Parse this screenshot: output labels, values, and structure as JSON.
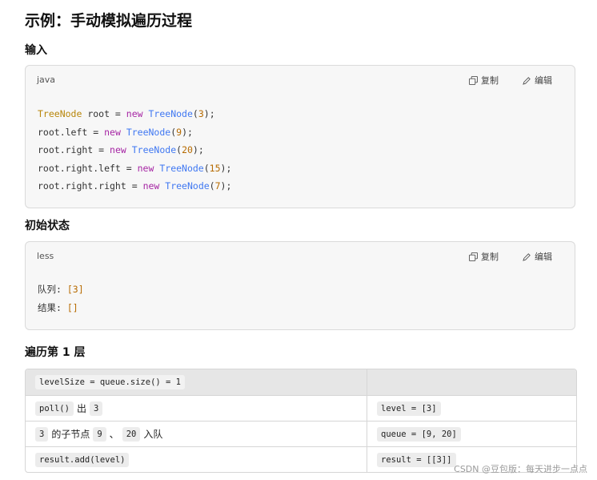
{
  "title": "示例：手动模拟遍历过程",
  "section_input": "输入",
  "section_initial": "初始状态",
  "section_level1": "遍历第 1 层",
  "code1": {
    "lang": "java",
    "copy": "复制",
    "edit": "编辑",
    "lines": [
      {
        "parts": [
          [
            "cls",
            "TreeNode"
          ],
          [
            "",
            " root = "
          ],
          [
            "kw",
            "new"
          ],
          [
            "",
            " "
          ],
          [
            "type",
            "TreeNode"
          ],
          [
            "",
            "("
          ],
          [
            "num",
            "3"
          ],
          [
            "",
            ");"
          ]
        ]
      },
      {
        "parts": [
          [
            "",
            "root.left = "
          ],
          [
            "kw",
            "new"
          ],
          [
            "",
            " "
          ],
          [
            "type",
            "TreeNode"
          ],
          [
            "",
            "("
          ],
          [
            "num",
            "9"
          ],
          [
            "",
            ");"
          ]
        ]
      },
      {
        "parts": [
          [
            "",
            "root.right = "
          ],
          [
            "kw",
            "new"
          ],
          [
            "",
            " "
          ],
          [
            "type",
            "TreeNode"
          ],
          [
            "",
            "("
          ],
          [
            "num",
            "20"
          ],
          [
            "",
            ");"
          ]
        ]
      },
      {
        "parts": [
          [
            "",
            "root.right.left = "
          ],
          [
            "kw",
            "new"
          ],
          [
            "",
            " "
          ],
          [
            "type",
            "TreeNode"
          ],
          [
            "",
            "("
          ],
          [
            "num",
            "15"
          ],
          [
            "",
            ");"
          ]
        ]
      },
      {
        "parts": [
          [
            "",
            "root.right.right = "
          ],
          [
            "kw",
            "new"
          ],
          [
            "",
            " "
          ],
          [
            "type",
            "TreeNode"
          ],
          [
            "",
            "("
          ],
          [
            "num",
            "7"
          ],
          [
            "",
            ");"
          ]
        ]
      }
    ]
  },
  "code2": {
    "lang": "less",
    "copy": "复制",
    "edit": "编辑",
    "lines": [
      {
        "parts": [
          [
            "",
            "队列: "
          ],
          [
            "num",
            "[3]"
          ]
        ]
      },
      {
        "parts": [
          [
            "",
            "结果: "
          ],
          [
            "num",
            "[]"
          ]
        ]
      }
    ]
  },
  "table": {
    "header": [
      "levelSize = queue.size() = 1",
      ""
    ],
    "rows": [
      {
        "left": [
          [
            "code",
            "poll()"
          ],
          [
            "text",
            "出"
          ],
          [
            "code",
            "3"
          ]
        ],
        "right": [
          [
            "code",
            "level = [3]"
          ]
        ]
      },
      {
        "left": [
          [
            "code",
            "3"
          ],
          [
            "text",
            "的子节点"
          ],
          [
            "code",
            "9"
          ],
          [
            "text",
            "、"
          ],
          [
            "code",
            "20"
          ],
          [
            "text",
            "入队"
          ]
        ],
        "right": [
          [
            "code",
            "queue = [9, 20]"
          ]
        ]
      },
      {
        "left": [
          [
            "code",
            "result.add(level)"
          ]
        ],
        "right": [
          [
            "code",
            "result = [[3]]"
          ]
        ]
      }
    ]
  },
  "watermark": "CSDN @豆包版：每天进步一点点"
}
